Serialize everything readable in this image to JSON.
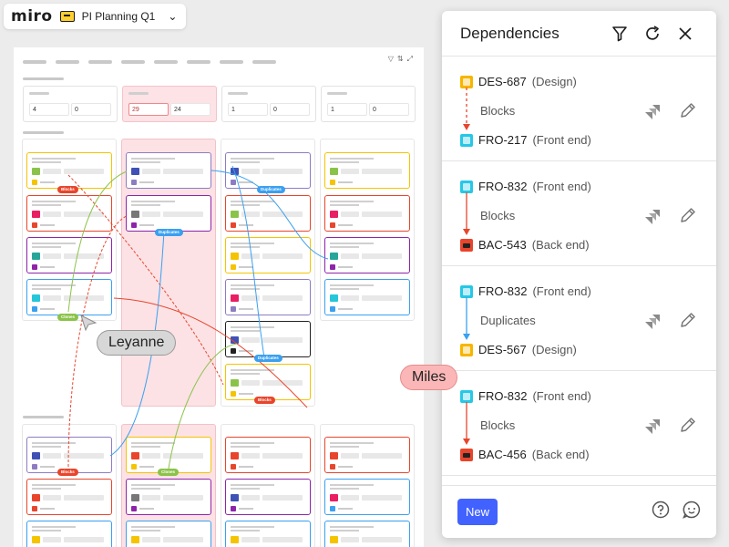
{
  "app": {
    "logo": "miro",
    "board_title": "PI Planning Q1"
  },
  "canvas": {
    "stats": [
      {
        "a": "4",
        "b": "0"
      },
      {
        "a": "29",
        "b": "24"
      },
      {
        "a": "1",
        "b": "0"
      },
      {
        "a": "1",
        "b": "0"
      }
    ],
    "link_tags": [
      {
        "label": "Blocks",
        "color": "#e8452c"
      },
      {
        "label": "Duplicates",
        "color": "#3aa0f0"
      },
      {
        "label": "Duplicates",
        "color": "#3aa0f0"
      },
      {
        "label": "Clones",
        "color": "#8bc34a"
      },
      {
        "label": "Duplicates",
        "color": "#3aa0f0"
      },
      {
        "label": "Blocks",
        "color": "#e8452c"
      },
      {
        "label": "Blocks",
        "color": "#e8452c"
      },
      {
        "label": "Clones",
        "color": "#8bc34a"
      }
    ]
  },
  "cursors": [
    {
      "name": "Leyanne",
      "color": "#d7d7d7"
    },
    {
      "name": "Miles",
      "color": "#fbb7b7"
    }
  ],
  "panel": {
    "title": "Dependencies",
    "dependencies": [
      {
        "from_code": "DES-687",
        "from_team": "(Design)",
        "from_type": "design",
        "relation": "Blocks",
        "line_color": "#e8452c",
        "dashed": true,
        "to_code": "FRO-217",
        "to_team": "(Front end)",
        "to_type": "front"
      },
      {
        "from_code": "FRO-832",
        "from_team": "(Front end)",
        "from_type": "front",
        "relation": "Blocks",
        "line_color": "#e8452c",
        "dashed": false,
        "to_code": "BAC-543",
        "to_team": "(Back end)",
        "to_type": "back"
      },
      {
        "from_code": "FRO-832",
        "from_team": "(Front end)",
        "from_type": "front",
        "relation": "Duplicates",
        "line_color": "#3aa0f0",
        "dashed": false,
        "to_code": "DES-567",
        "to_team": "(Design)",
        "to_type": "design"
      },
      {
        "from_code": "FRO-832",
        "from_team": "(Front end)",
        "from_type": "front",
        "relation": "Blocks",
        "line_color": "#e8452c",
        "dashed": false,
        "to_code": "BAC-456",
        "to_team": "(Back end)",
        "to_type": "back"
      }
    ],
    "new_button": "New"
  },
  "colors": {
    "accent": "#4262ff",
    "blocks": "#e8452c",
    "duplicates": "#3aa0f0",
    "clones": "#8bc34a"
  }
}
